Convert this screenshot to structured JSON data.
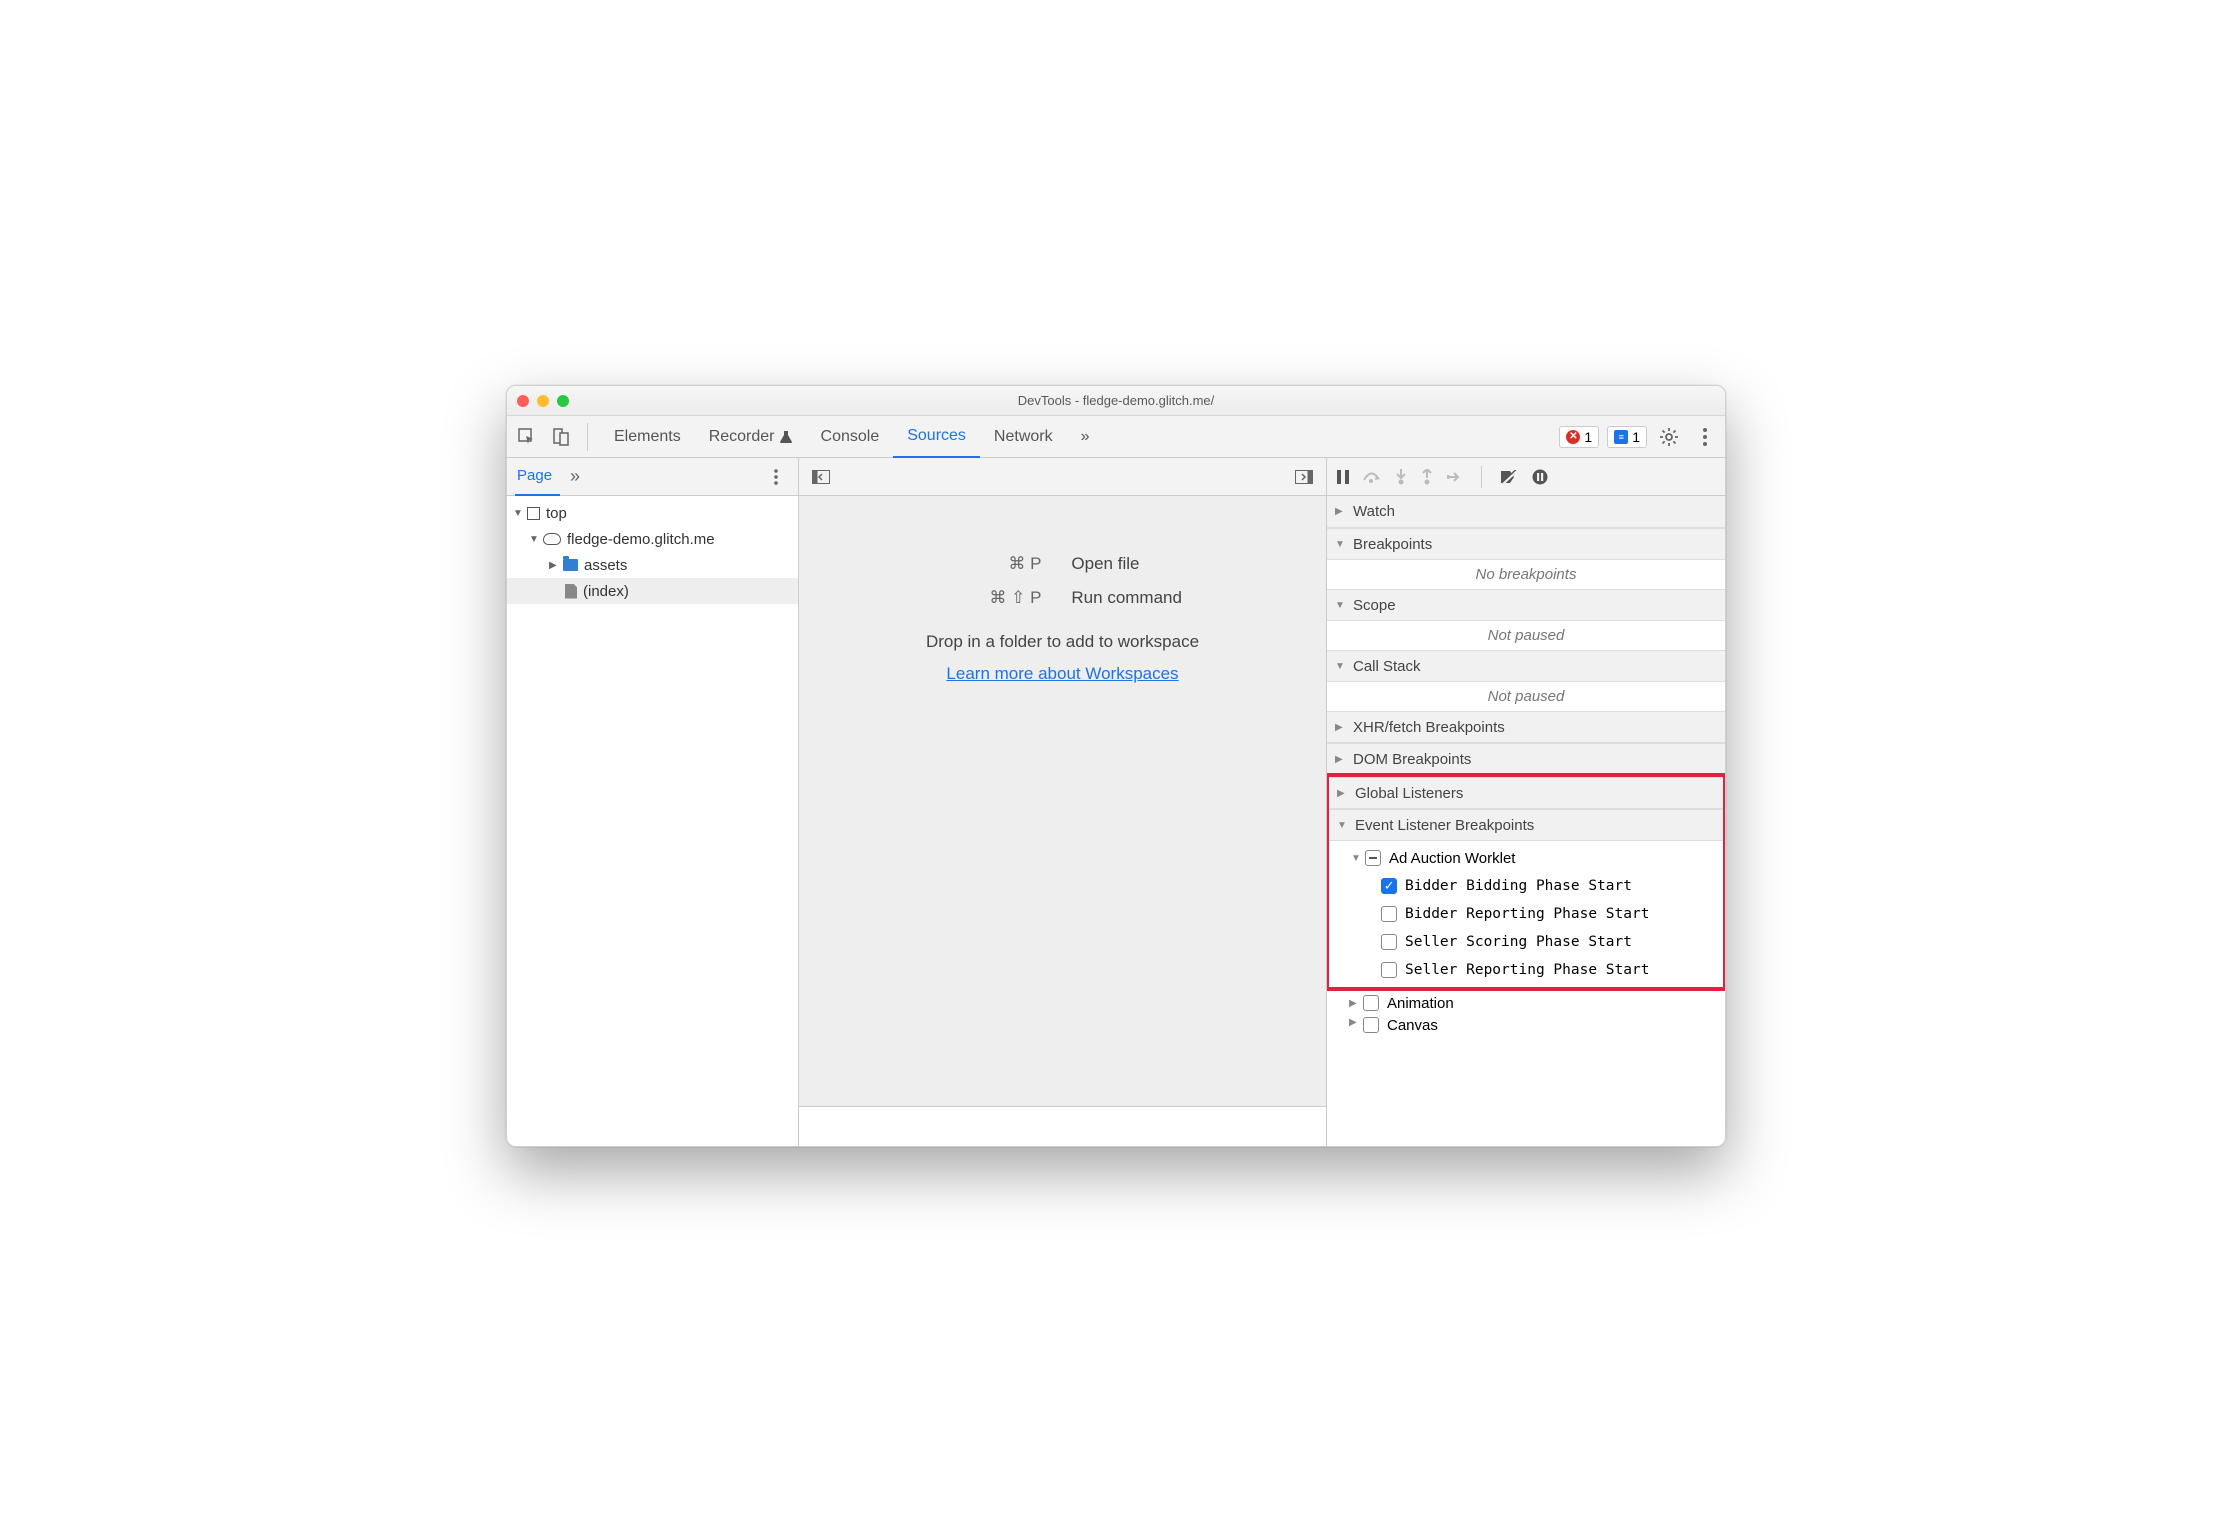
{
  "window": {
    "title": "DevTools - fledge-demo.glitch.me/"
  },
  "toolbar": {
    "tabs": [
      "Elements",
      "Recorder",
      "Console",
      "Sources",
      "Network"
    ],
    "active_tab": "Sources",
    "more": "»",
    "errors_count": "1",
    "messages_count": "1"
  },
  "subbar": {
    "page_tab": "Page",
    "more": "»"
  },
  "tree": {
    "top": "top",
    "domain": "fledge-demo.glitch.me",
    "folder": "assets",
    "file": "(index)"
  },
  "mid": {
    "open_file_keys": "⌘ P",
    "open_file_label": "Open file",
    "run_cmd_keys": "⌘ ⇧ P",
    "run_cmd_label": "Run command",
    "workspace_text": "Drop in a folder to add to workspace",
    "workspace_link": "Learn more about Workspaces"
  },
  "right": {
    "watch": "Watch",
    "breakpoints": "Breakpoints",
    "no_breakpoints": "No breakpoints",
    "scope": "Scope",
    "not_paused1": "Not paused",
    "call_stack": "Call Stack",
    "not_paused2": "Not paused",
    "xhr": "XHR/fetch Breakpoints",
    "dom": "DOM Breakpoints",
    "global": "Global Listeners",
    "event_listener": "Event Listener Breakpoints",
    "ad_auction": "Ad Auction Worklet",
    "events": {
      "e1": "Bidder Bidding Phase Start",
      "e2": "Bidder Reporting Phase Start",
      "e3": "Seller Scoring Phase Start",
      "e4": "Seller Reporting Phase Start"
    },
    "animation": "Animation",
    "canvas": "Canvas"
  }
}
